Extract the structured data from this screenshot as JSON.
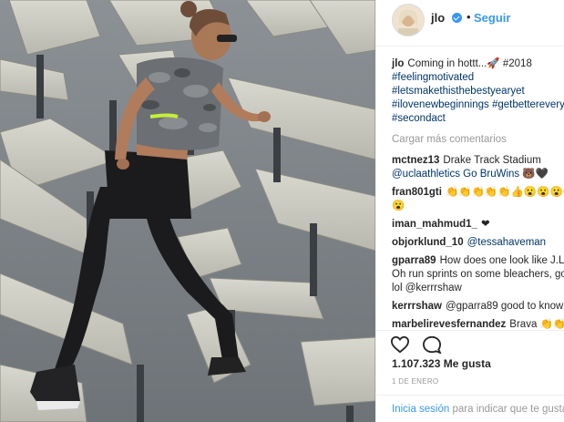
{
  "header": {
    "username": "jlo",
    "separator": "•",
    "follow_label": "Seguir"
  },
  "caption": {
    "username": "jlo",
    "lines": [
      "Coming in hottt...🚀 #2018",
      "#feelingmotivated",
      "#letsmakethisthebestyearyet",
      "#ilovenewbeginnings #getbetterevery",
      "#secondact"
    ]
  },
  "load_more_label": "Cargar más comentarios",
  "comments": [
    {
      "user": "mctnez13",
      "lines": [
        "Drake Track Stadium",
        "@uclaathletics Go BruWins 🐻🖤"
      ]
    },
    {
      "user": "fran801gti",
      "lines": [
        "👏👏👏👏👏👍😮😮😮😮",
        "😮"
      ]
    },
    {
      "user": "iman_mahmud1_",
      "lines": [
        "❤"
      ]
    },
    {
      "user": "objorklund_10",
      "lines": [
        "@tessahaveman"
      ]
    },
    {
      "user": "gparra89",
      "lines": [
        "How does one look like J.LO?",
        "Oh run sprints on some bleachers, go",
        "lol @kerrrshaw"
      ]
    },
    {
      "user": "kerrrshaw",
      "lines": [
        "@gparra89 good to know!"
      ]
    },
    {
      "user": "marbelirevesfernandez",
      "lines": [
        "Brava 👏👏"
      ]
    }
  ],
  "actions": {
    "like_icon": "heart-icon",
    "comment_icon": "comment-bubble-icon"
  },
  "likes": {
    "count": "1.107.323",
    "label": "Me gusta"
  },
  "date": "1 DE ENERO",
  "login": {
    "link_label": "Inicia sesión",
    "rest_label": "para indicar que te gusta"
  },
  "colors": {
    "accent": "#3897f0",
    "hashtag": "#003569",
    "muted": "#999999",
    "text": "#262626"
  }
}
